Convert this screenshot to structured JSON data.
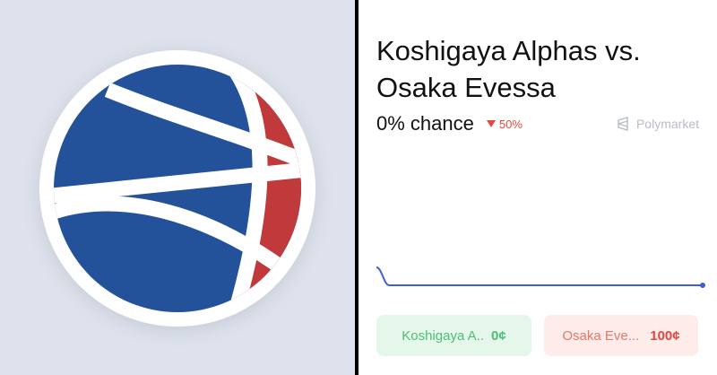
{
  "market": {
    "title": "Koshigaya Alphas vs. Osaka Evessa",
    "chance": "0% chance",
    "change": "50%",
    "change_direction": "down",
    "source": "Polymarket"
  },
  "outcomes": [
    {
      "name": "Koshigaya A..",
      "price": "0¢"
    },
    {
      "name": "Osaka Eve...",
      "price": "100¢"
    }
  ],
  "colors": {
    "ball_blue": "#23529b",
    "ball_red": "#c0393b",
    "line": "#3c5fd6",
    "up_green": "#4cbf76",
    "down_red": "#e5483b",
    "left_bg": "#dde2ec"
  },
  "chart_data": {
    "type": "line",
    "series": [
      {
        "values": [
          50,
          0,
          0,
          0,
          0,
          0,
          0,
          0,
          0,
          0,
          0,
          0
        ]
      }
    ],
    "ylim": [
      0,
      100
    ],
    "grid": false
  }
}
